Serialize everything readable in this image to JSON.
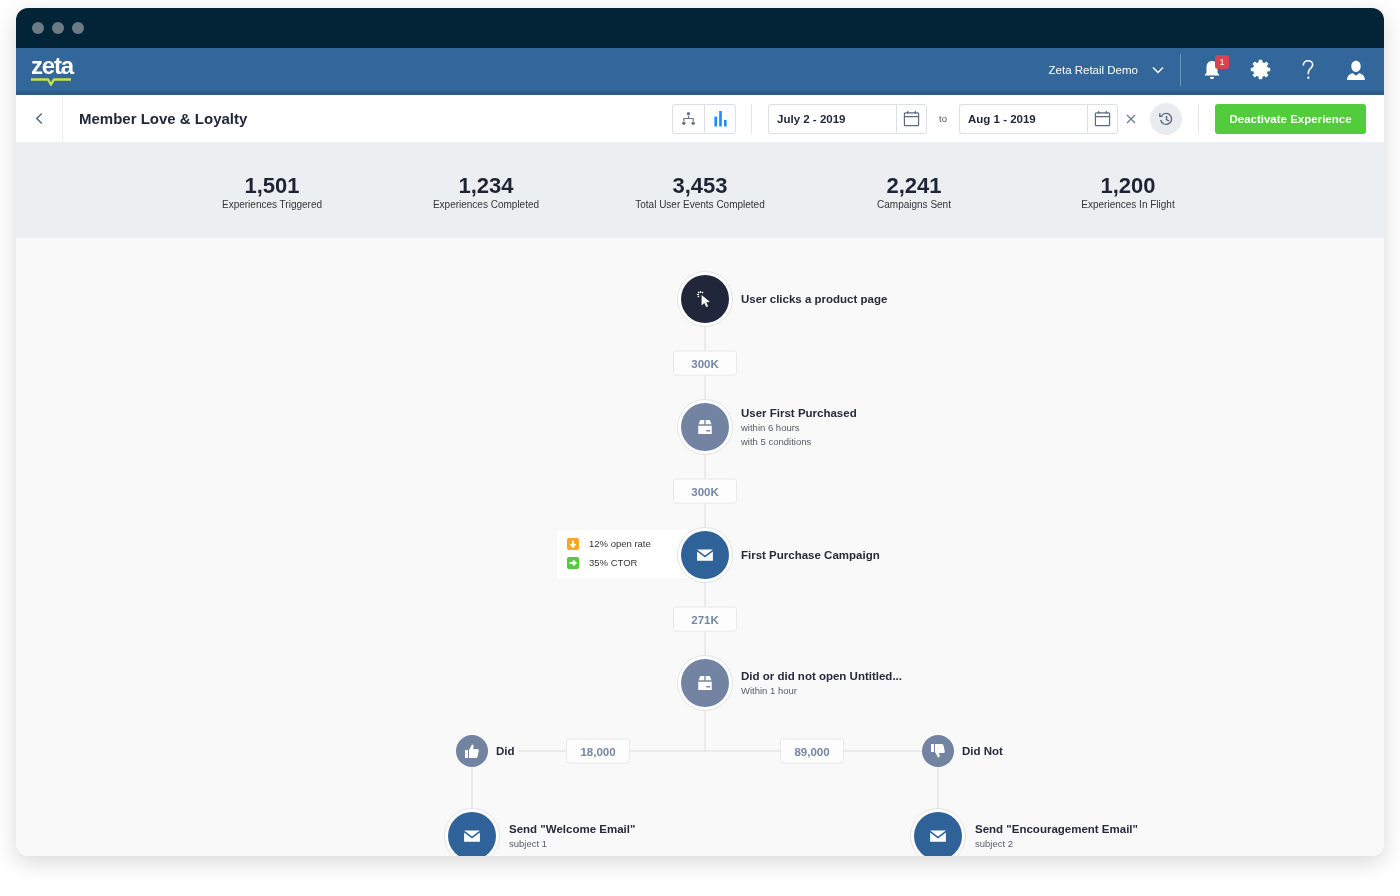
{
  "header": {
    "logo": "zeta",
    "account": "Zeta Retail Demo",
    "notifications": "1"
  },
  "toolbar": {
    "title": "Member Love & Loyalty",
    "views": [
      {
        "kind": "tree",
        "selected": false
      },
      {
        "kind": "chart",
        "selected": true
      }
    ],
    "date_from": "July 2 - 2019",
    "to_label": "to",
    "date_to": "Aug 1 - 2019",
    "action": "Deactivate Experience"
  },
  "stats": [
    {
      "value": "1,501",
      "label": "Experiences Triggered"
    },
    {
      "value": "1,234",
      "label": "Experiences Completed"
    },
    {
      "value": "3,453",
      "label": "Total User Events Completed"
    },
    {
      "value": "2,241",
      "label": "Campaigns Sent"
    },
    {
      "value": "1,200",
      "label": "Experiences In Flight"
    }
  ],
  "flow": {
    "steps": [
      {
        "kind": "trigger",
        "title": "User clicks a product page"
      },
      {
        "kind": "count",
        "value": "300K"
      },
      {
        "kind": "condition",
        "title": "User First Purchased",
        "details": [
          "within 6 hours",
          "with 5 conditions"
        ]
      },
      {
        "kind": "count",
        "value": "300K"
      },
      {
        "kind": "email",
        "title": "First Purchase Campaign",
        "metrics": [
          {
            "falling": true,
            "color": "#f5a623",
            "label": "12% open rate"
          },
          {
            "falling": false,
            "color": "#52cc3a",
            "label": "35% CTOR"
          }
        ]
      },
      {
        "kind": "count",
        "value": "271K"
      },
      {
        "kind": "condition",
        "title": "Did or did not open Untitled...",
        "details": [
          "Within 1 hour"
        ]
      }
    ],
    "branches": [
      {
        "kind": "positive",
        "label": "Did",
        "count": "18,000",
        "steps": [
          {
            "kind": "email",
            "title": "Send \"Welcome Email\"",
            "details": [
              "subject 1"
            ]
          }
        ]
      },
      {
        "kind": "negative",
        "label": "Did Not",
        "count": "89,000",
        "steps": [
          {
            "kind": "email",
            "title": "Send \"Encouragement Email\"",
            "details": [
              "subject 2"
            ]
          }
        ]
      }
    ]
  }
}
